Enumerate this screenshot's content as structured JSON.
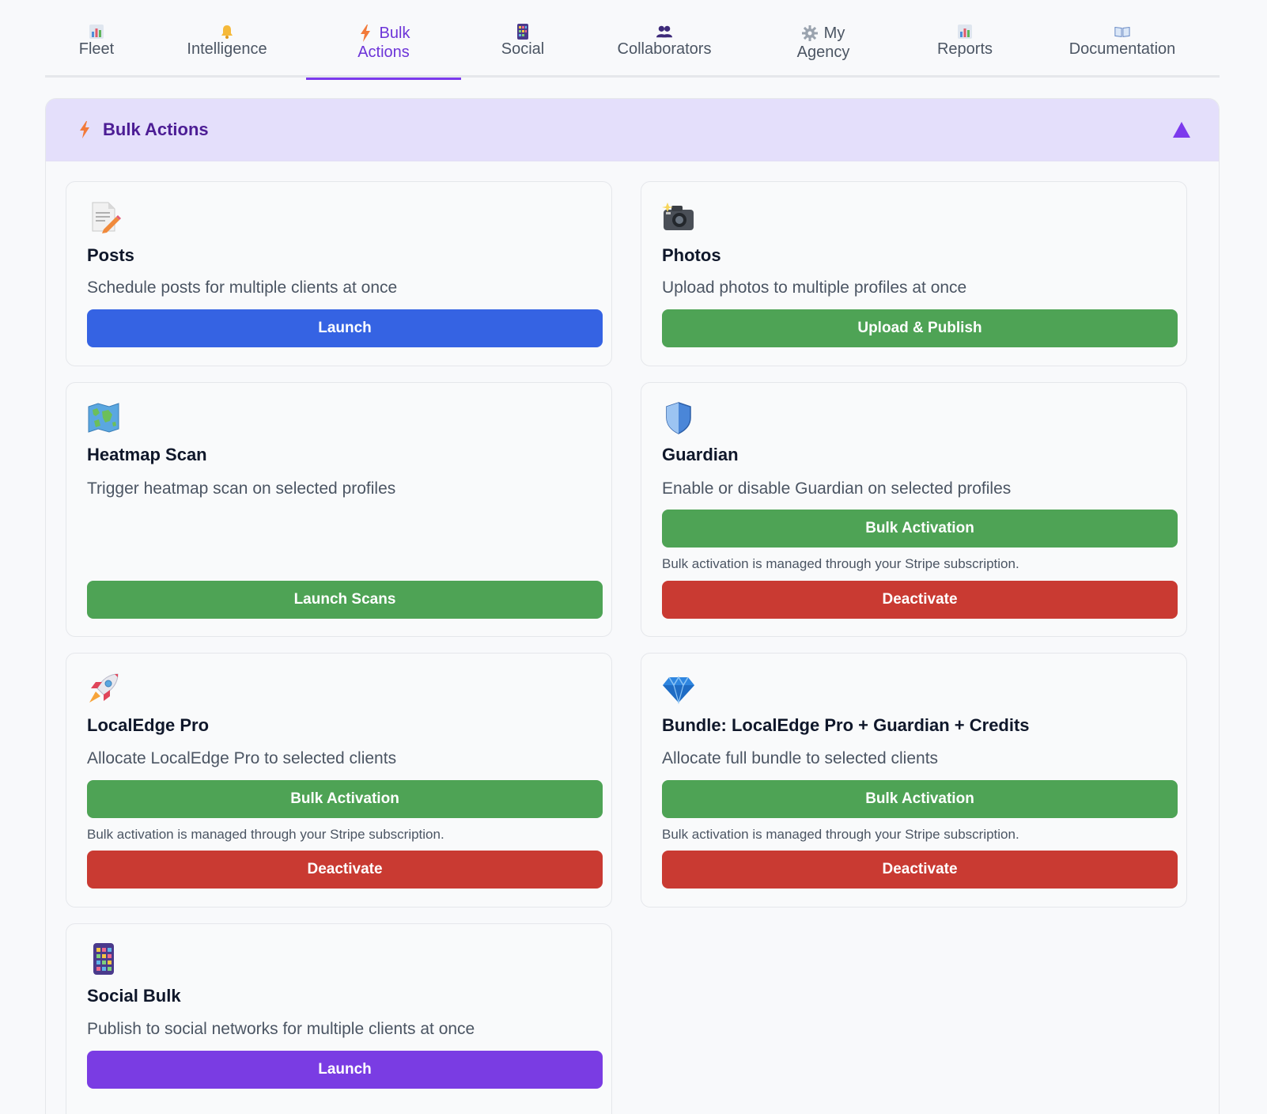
{
  "tabs": [
    {
      "label_line1": "",
      "label_line2": "Fleet",
      "icon": "bar-chart-icon",
      "active": false
    },
    {
      "label_line1": "",
      "label_line2": "Intelligence",
      "icon": "bell-icon",
      "active": false
    },
    {
      "label_line1": "Bulk",
      "label_line2": "Actions",
      "icon": "lightning-icon",
      "active": true
    },
    {
      "label_line1": "",
      "label_line2": "Social",
      "icon": "phone-icon",
      "active": false
    },
    {
      "label_line1": "",
      "label_line2": "Collaborators",
      "icon": "people-icon",
      "active": false
    },
    {
      "label_line1": "My",
      "label_line2": "Agency",
      "icon": "gear-icon",
      "active": false
    },
    {
      "label_line1": "",
      "label_line2": "Reports",
      "icon": "bar-chart-icon",
      "active": false
    },
    {
      "label_line1": "",
      "label_line2": "Documentation",
      "icon": "book-icon",
      "active": false
    }
  ],
  "panel": {
    "title": "Bulk Actions",
    "icon": "lightning-icon",
    "collapse_icon": "triangle-up-icon"
  },
  "cards": {
    "posts": {
      "icon": "memo-icon",
      "title": "Posts",
      "description": "Schedule posts for multiple clients at once",
      "button": "Launch"
    },
    "photos": {
      "icon": "camera-icon",
      "title": "Photos",
      "description": "Upload photos to multiple profiles at once",
      "button": "Upload & Publish"
    },
    "heatmap": {
      "icon": "map-icon",
      "title": "Heatmap Scan",
      "description": "Trigger heatmap scan on selected profiles",
      "button": "Launch Scans"
    },
    "guardian": {
      "icon": "shield-icon",
      "title": "Guardian",
      "description": "Enable or disable Guardian on selected profiles",
      "activate_button": "Bulk Activation",
      "note": "Bulk activation is managed through your Stripe subscription.",
      "deactivate_button": "Deactivate"
    },
    "localedge": {
      "icon": "rocket-icon",
      "title": "LocalEdge Pro",
      "description": "Allocate LocalEdge Pro to selected clients",
      "activate_button": "Bulk Activation",
      "note": "Bulk activation is managed through your Stripe subscription.",
      "deactivate_button": "Deactivate"
    },
    "bundle": {
      "icon": "gem-icon",
      "title": "Bundle: LocalEdge Pro + Guardian + Credits",
      "description": "Allocate full bundle to selected clients",
      "activate_button": "Bulk Activation",
      "note": "Bulk activation is managed through your Stripe subscription.",
      "deactivate_button": "Deactivate"
    },
    "social": {
      "icon": "phone-icon",
      "title": "Social Bulk",
      "description": "Publish to social networks for multiple clients at once",
      "button": "Launch"
    }
  },
  "colors": {
    "accent": "#7c3aed",
    "blue": "#3563e3",
    "green": "#4ea355",
    "red": "#c93a32",
    "purple": "#7a3ce3",
    "header_bg": "#e4dffb"
  }
}
